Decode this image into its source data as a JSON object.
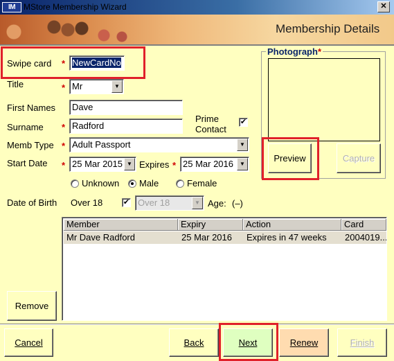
{
  "window": {
    "app_icon_text": "M",
    "title": "MStore Membership Wizard",
    "close_glyph": "✕"
  },
  "banner": {
    "title": "Membership Details"
  },
  "form": {
    "swipe_card": {
      "label": "Swipe card",
      "value": "NewCardNo"
    },
    "title": {
      "label": "Title",
      "value": "Mr"
    },
    "first_names": {
      "label": "First Names",
      "value": "Dave"
    },
    "surname": {
      "label": "Surname",
      "value": "Radford"
    },
    "prime_contact": {
      "label_line1": "Prime",
      "label_line2": "Contact",
      "checked": true
    },
    "memb_type": {
      "label": "Memb Type",
      "value": "Adult Passport"
    },
    "start_date": {
      "label": "Start Date",
      "value": "25 Mar 2015"
    },
    "expires": {
      "label": "Expires",
      "value": "25 Mar 2016"
    },
    "gender": {
      "options": [
        "Unknown",
        "Male",
        "Female"
      ],
      "selected": "Male"
    },
    "dob": {
      "label": "Date of Birth",
      "over18_label": "Over 18",
      "over18_checked": true,
      "combo_value": "Over 18",
      "age_label": "Age:",
      "age_value": "(–)"
    },
    "required_marker": "*",
    "check_glyph": "✔",
    "arrow_glyph": "▼"
  },
  "photo": {
    "title": "Photograph",
    "preview_label": "Preview",
    "capture_label": "Capture"
  },
  "table": {
    "columns": [
      "Member",
      "Expiry",
      "Action",
      "Card"
    ],
    "rows": [
      {
        "member": "Mr Dave Radford",
        "expiry": "25 Mar 2016",
        "action": "Expires in 47 weeks",
        "card": "2004019..."
      }
    ]
  },
  "buttons": {
    "remove": "Remove",
    "cancel": "Cancel",
    "back": "Back",
    "next": "Next",
    "renew": "Renew",
    "finish": "Finish"
  },
  "colors": {
    "background": "#ffffc0",
    "highlight": "#e0202a",
    "title_bar": "#0a246a"
  }
}
